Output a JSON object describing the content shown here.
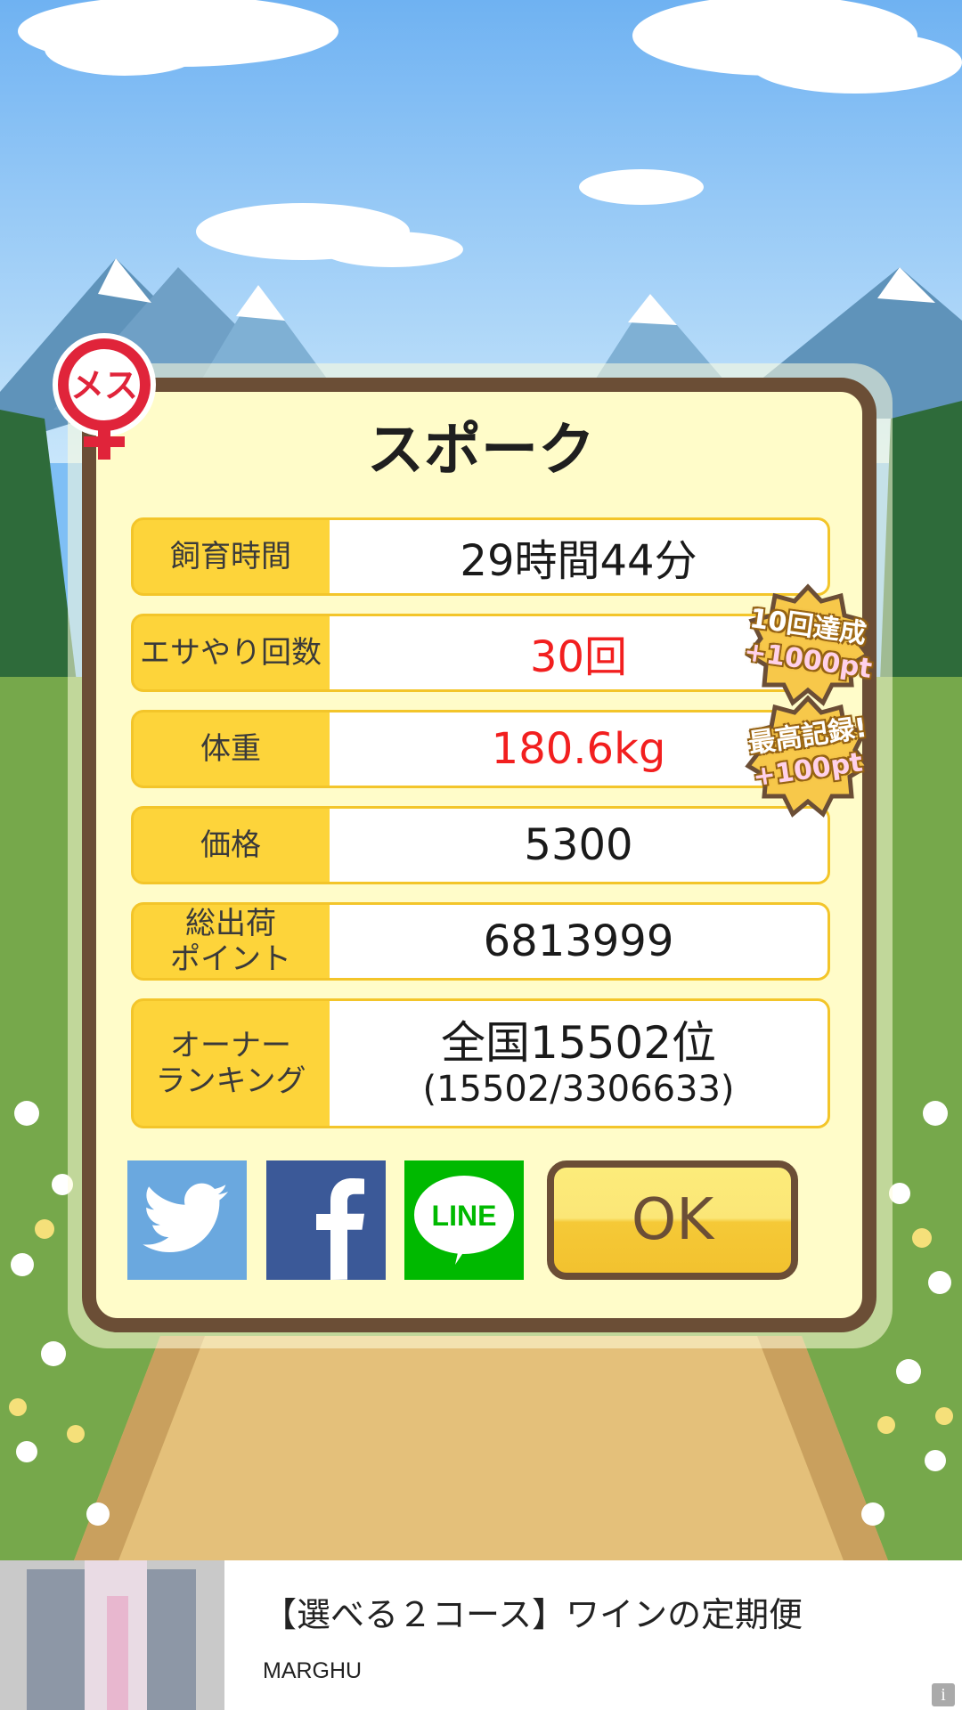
{
  "pet": {
    "name": "スポーク",
    "gender_label": "メス"
  },
  "stats": [
    {
      "label": "飼育時間",
      "value": "29時間44分",
      "highlight": false
    },
    {
      "label": "エサやり回数",
      "value": "30回",
      "highlight": true
    },
    {
      "label": "体重",
      "value": "180.6kg",
      "highlight": true
    },
    {
      "label": "価格",
      "value": "5300",
      "highlight": false
    },
    {
      "label": "総出荷\nポイント",
      "value": "6813999",
      "highlight": false
    }
  ],
  "ranking": {
    "label": "オーナー\nランキング",
    "rank": "全国15502位",
    "detail": "(15502/3306633)"
  },
  "badges": [
    {
      "line1": "10回達成",
      "line2": "+1000pt"
    },
    {
      "line1": "最高記録!",
      "line2": "+100pt"
    }
  ],
  "share": {
    "line_label": "LINE"
  },
  "ok_label": "OK",
  "ad": {
    "title": "【選べる２コース】ワインの定期便",
    "brand": "MARGHU",
    "info": "i"
  },
  "colors": {
    "panel_border": "#6b4e36",
    "panel_fill": "#fffcc9",
    "label_fill": "#fdd43a",
    "highlight_text": "#f21f1f",
    "twitter": "#6aa8df",
    "facebook": "#3b5998",
    "line": "#00b900"
  }
}
